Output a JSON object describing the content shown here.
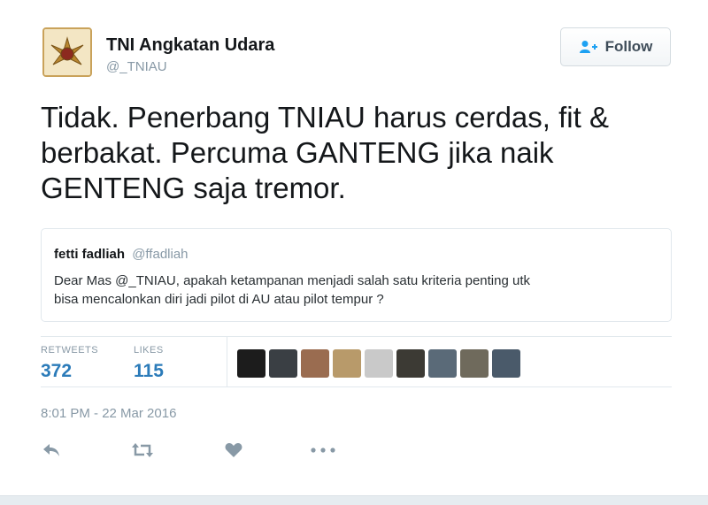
{
  "tweet": {
    "author_name": "TNI Angkatan Udara",
    "author_handle": "@_TNIAU",
    "follow_label": "Follow",
    "text_lines": [
      "Tidak. Penerbang TNIAU harus cerdas, fit &",
      "berbakat. Percuma GANTENG jika naik",
      "GENTENG saja tremor."
    ],
    "quoted": {
      "name": "fetti fadliah",
      "handle": "@ffadliah",
      "text_lines": [
        "Dear Mas @_TNIAU, apakah ketampanan menjadi salah satu kriteria penting utk",
        "bisa  mencalonkan diri jadi pilot di AU atau pilot tempur ?"
      ]
    },
    "stats": {
      "retweets_label": "RETWEETS",
      "retweets_value": "372",
      "likes_label": "LIKES",
      "likes_value": "115"
    },
    "timestamp": "8:01 PM - 22 Mar 2016",
    "liker_avatars": [
      "#1c1c1c",
      "#3a3f44",
      "#9a6c50",
      "#b89a6a",
      "#c9c9c9",
      "#3c3a34",
      "#5a6a78",
      "#6f6a5c",
      "#4a5a6a"
    ],
    "actions": [
      "reply-icon",
      "retweet-icon",
      "like-icon",
      "more-icon"
    ]
  },
  "colors": {
    "link_blue": "#2b7bb9",
    "muted": "#8899a6",
    "follow_icon": "#1da1f2"
  }
}
